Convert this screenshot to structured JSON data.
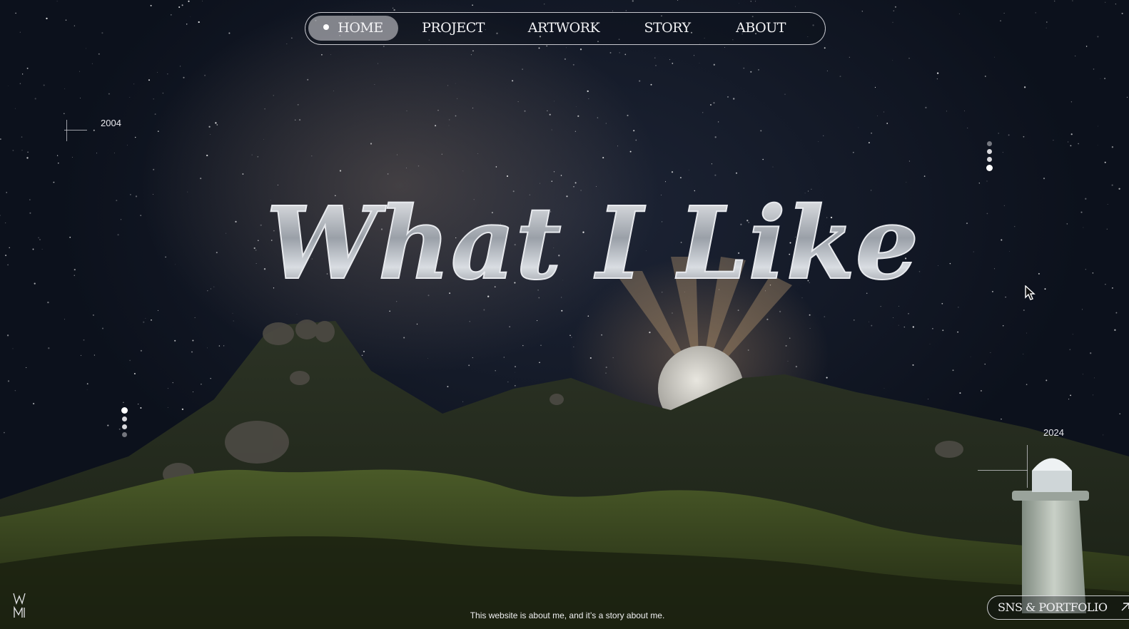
{
  "nav": {
    "items": [
      {
        "label": "HOME",
        "active": true
      },
      {
        "label": "PROJECT",
        "active": false
      },
      {
        "label": "ARTWORK",
        "active": false
      },
      {
        "label": "STORY",
        "active": false
      },
      {
        "label": "ABOUT",
        "active": false
      }
    ]
  },
  "hero": {
    "title": "What I Like",
    "year_start": "2004",
    "year_end": "2024"
  },
  "footer": {
    "tagline": "This website is about me, and it’s a story about me.",
    "sns_label": "SNS & PORTFOLIO",
    "sns_icon": "arrow-up-right-icon",
    "logo_icon": "wm-monogram-icon"
  },
  "colors": {
    "accent": "#f2f2f4",
    "active_pill": "#c8c8cd"
  }
}
